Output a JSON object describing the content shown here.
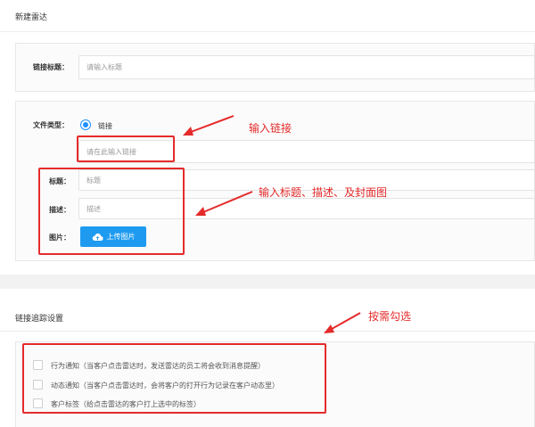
{
  "section_new": {
    "title": "新建雷达"
  },
  "link_title": {
    "label": "链接标题：",
    "placeholder": "请输入标题"
  },
  "file_type": {
    "label": "文件类型：",
    "option_label": "链接"
  },
  "link_input": {
    "placeholder": "请在此输入链接"
  },
  "details": {
    "title_label": "标题：",
    "title_placeholder": "标题",
    "desc_label": "描述：",
    "desc_placeholder": "描述",
    "image_label": "图片：",
    "upload_label": "上传图片"
  },
  "annotations": {
    "link": "输入链接",
    "details": "输入标题、描述、及封面图",
    "tracking": "按需勾选"
  },
  "section_tracking": {
    "title": "链接追踪设置"
  },
  "tracking_options": [
    {
      "label": "行为通知（当客户点击雷达时，发送雷达的员工将会收到消息提醒）"
    },
    {
      "label": "动态通知（当客户点击雷达时，会将客户的打开行为记录在客户动态里）"
    },
    {
      "label": "客户标签（给点击雷达的客户打上选中的标签）"
    }
  ],
  "colors": {
    "accent": "#1e9bf0",
    "annotation": "#e52b2b"
  }
}
